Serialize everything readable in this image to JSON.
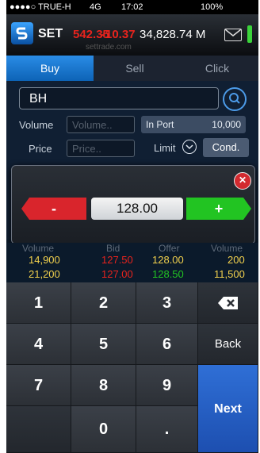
{
  "status_bar": {
    "carrier": "●●●●○ TRUE-H",
    "network": "4G",
    "time": "17:02",
    "battery": "100%"
  },
  "header": {
    "brand": "SET",
    "index_change": "542.35",
    "index_delta": "-10.37",
    "index_value": "34,828.74 M",
    "sub_url": "settrade.com"
  },
  "tabs": [
    "Buy",
    "Sell",
    "Click"
  ],
  "form": {
    "symbol": "BH",
    "volume_label": "Volume",
    "volume_placeholder": "Volume..",
    "in_port_label": "In Port",
    "in_port_value": "10,000",
    "price_label": "Price",
    "price_placeholder": "Price..",
    "limit_label": "Limit",
    "cond_label": "Cond."
  },
  "price_dialog": {
    "minus_label": "-",
    "price_value": "128.00",
    "plus_label": "+",
    "close_label": "✕"
  },
  "book": {
    "headers": [
      "Volume",
      "Bid",
      "Offer",
      "Volume"
    ],
    "rows": [
      {
        "bid_volume": "14,900",
        "bid": "127.50",
        "offer": "128.00",
        "offer_volume": "200"
      },
      {
        "bid_volume": "21,200",
        "bid": "127.00",
        "offer": "128.50",
        "offer_volume": "11,500"
      }
    ]
  },
  "keypad": {
    "keys": [
      "1",
      "2",
      "3",
      "4",
      "5",
      "6",
      "7",
      "8",
      "9",
      "0",
      "."
    ],
    "back_label": "Back",
    "next_label": "Next"
  },
  "colors": {
    "accent_blue": "#0d63b6",
    "negative_red": "#e8231d",
    "positive_green": "#22c422",
    "offer_yellow": "#f2d14d"
  }
}
